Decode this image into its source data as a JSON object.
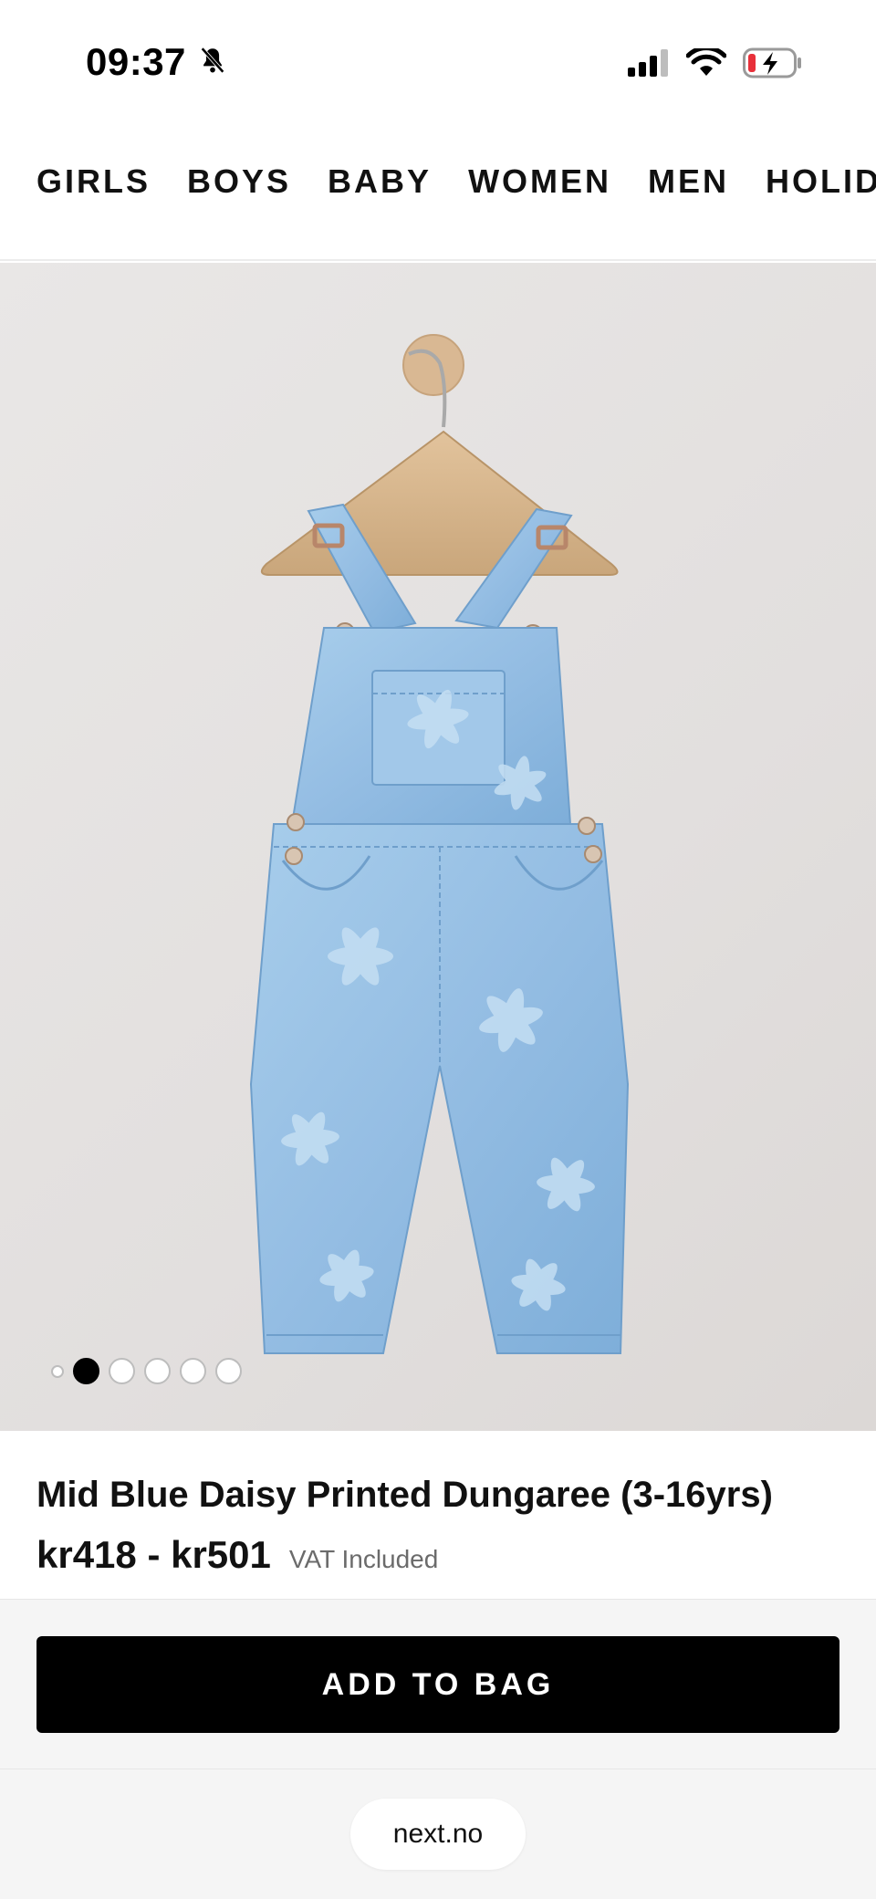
{
  "status_bar": {
    "time": "09:37",
    "icons": [
      "bell-slash-icon",
      "cellular-signal-icon",
      "wifi-icon",
      "battery-charging-icon"
    ]
  },
  "category_nav": {
    "items": [
      "GIRLS",
      "BOYS",
      "BABY",
      "WOMEN",
      "MEN",
      "HOLIDAY"
    ]
  },
  "gallery": {
    "image_subject": "denim-dungaree-on-hanger",
    "total_images": 6,
    "active_index": 1
  },
  "product": {
    "title": "Mid Blue Daisy Printed Dungaree (3-16yrs)",
    "price": "kr418 - kr501",
    "vat_note": "VAT Included"
  },
  "actions": {
    "add_to_bag_label": "ADD TO BAG"
  },
  "browser": {
    "url": "next.no"
  },
  "colors": {
    "primary_button": "#000000",
    "primary_button_text": "#ffffff",
    "denim": "#9cc3e4",
    "background_image": "#e6e3e2"
  }
}
